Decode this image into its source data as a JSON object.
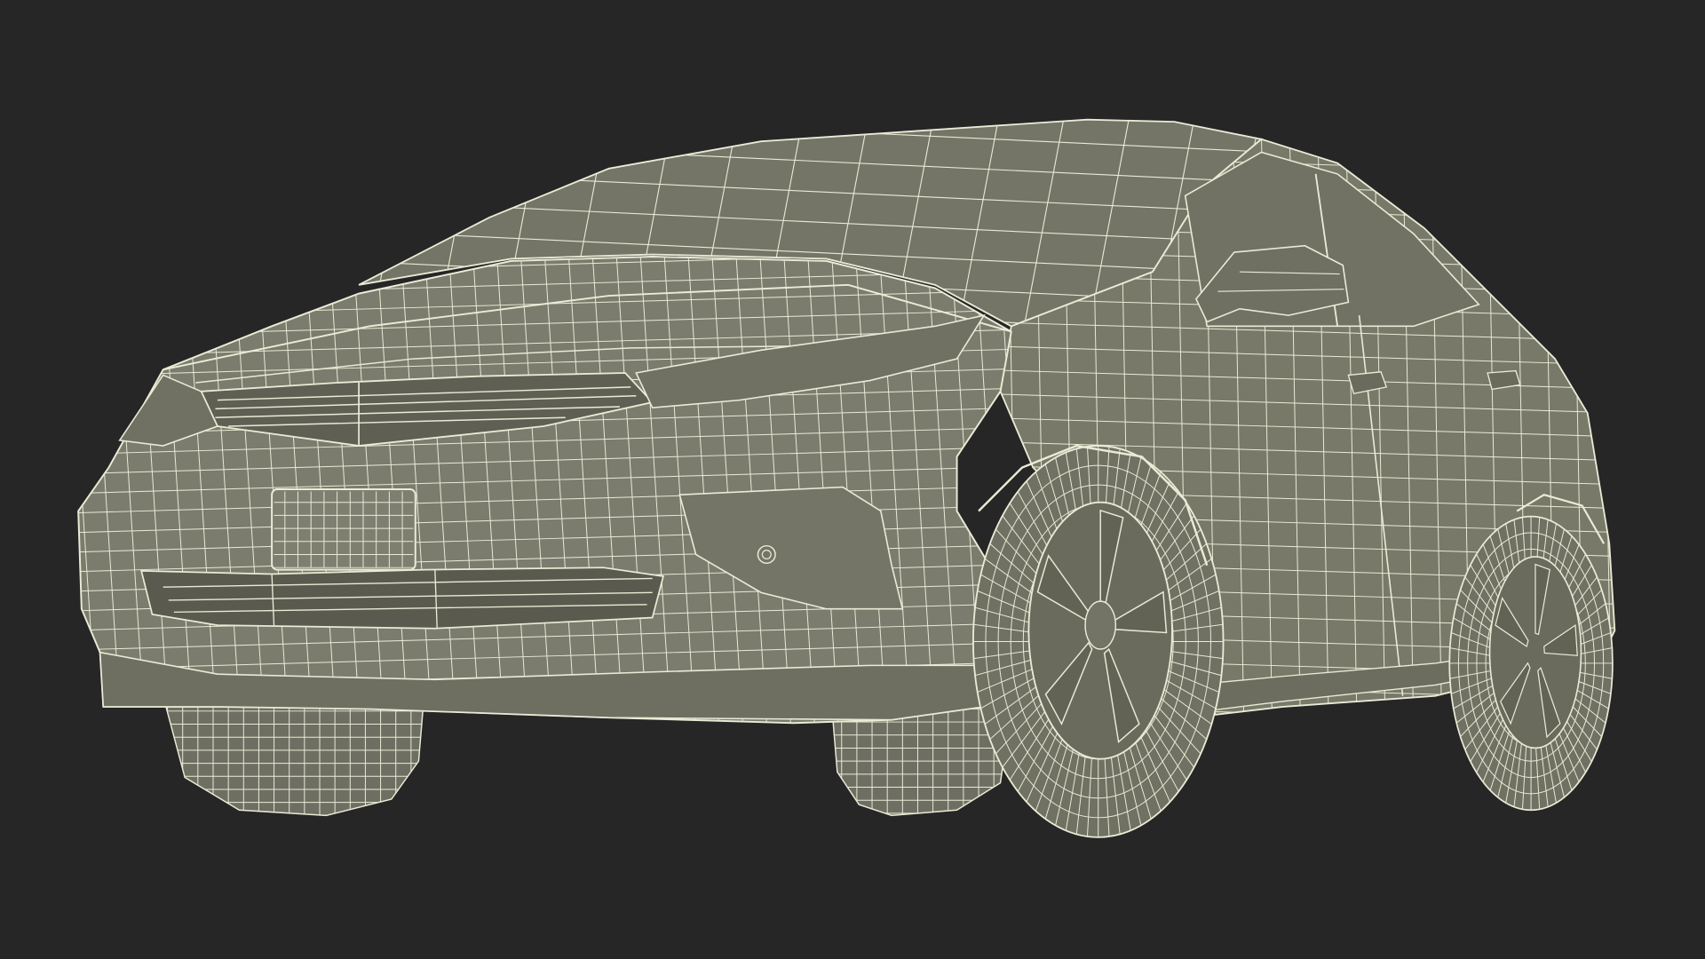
{
  "scene": {
    "subject": "car-wireframe-render",
    "colors": {
      "background": "#262626",
      "body": "#7a7b6c",
      "body_shade": "#6b6c5e",
      "body_dark": "#5c5d50",
      "body_light": "#8a8b7b",
      "wire": "#e9ebd6",
      "tire": "#6e6f62"
    }
  }
}
